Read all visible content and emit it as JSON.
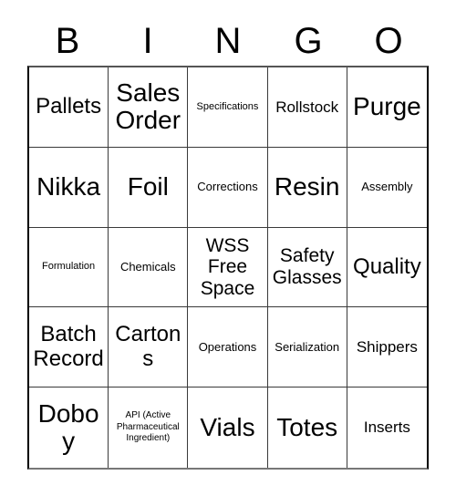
{
  "card": {
    "header_letters": [
      "B",
      "I",
      "N",
      "G",
      "O"
    ],
    "columns": 5,
    "rows": 5,
    "free_space_label": "WSS Free Space",
    "free_space_position": {
      "row": 3,
      "column": 3
    },
    "colors": {
      "background": "#ffffff",
      "text": "#000000",
      "grid_line": "#3a3a3a",
      "border": "#000000"
    },
    "cells": [
      {
        "text": "Pallets",
        "size": "xl"
      },
      {
        "text": "Sales Order",
        "size": "xxl"
      },
      {
        "text": "Specifications",
        "size": "xs"
      },
      {
        "text": "Rollstock",
        "size": "m"
      },
      {
        "text": "Purge",
        "size": "xxl"
      },
      {
        "text": "Nikka",
        "size": "xxl"
      },
      {
        "text": "Foil",
        "size": "xxl"
      },
      {
        "text": "Corrections",
        "size": "s"
      },
      {
        "text": "Resin",
        "size": "xxl"
      },
      {
        "text": "Assembly",
        "size": "s"
      },
      {
        "text": "Formulation",
        "size": "xs"
      },
      {
        "text": "Chemicals",
        "size": "s"
      },
      {
        "text": "WSS Free Space",
        "size": "l"
      },
      {
        "text": "Safety Glasses",
        "size": "l"
      },
      {
        "text": "Quality",
        "size": "xl"
      },
      {
        "text": "Batch Record",
        "size": "xl"
      },
      {
        "text": "Cartons",
        "size": "xl"
      },
      {
        "text": "Operations",
        "size": "s"
      },
      {
        "text": "Serialization",
        "size": "s"
      },
      {
        "text": "Shippers",
        "size": "m"
      },
      {
        "text": "Doboy",
        "size": "xxl"
      },
      {
        "text": "API (Active Pharmaceutical Ingredient)",
        "size": "xxs"
      },
      {
        "text": "Vials",
        "size": "xxl"
      },
      {
        "text": "Totes",
        "size": "xxl"
      },
      {
        "text": "Inserts",
        "size": "m"
      }
    ]
  }
}
